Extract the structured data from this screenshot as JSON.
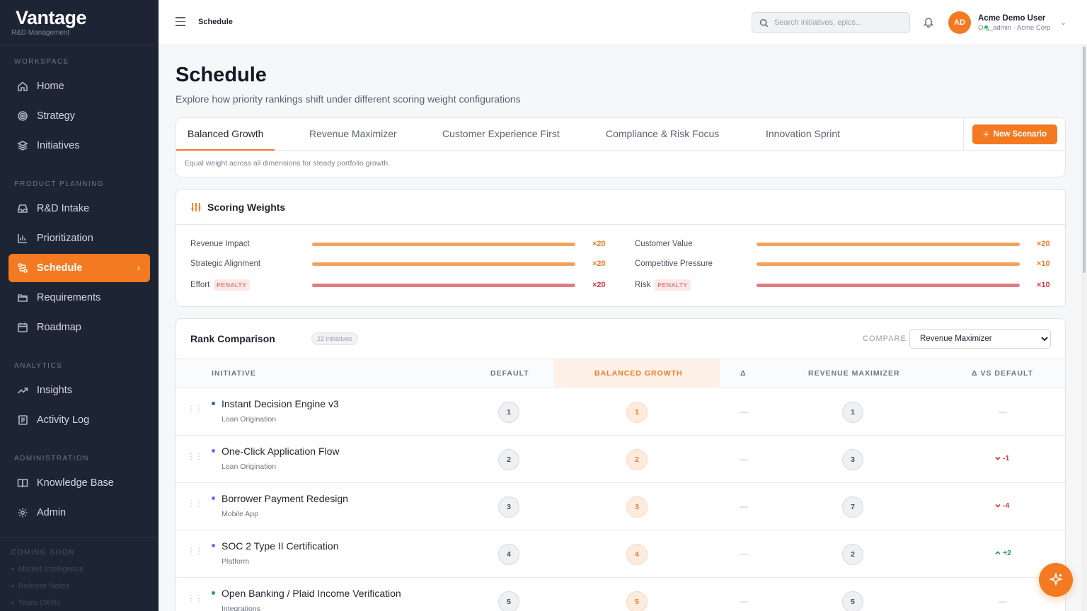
{
  "brand": {
    "name": "Vantage",
    "subtitle": "R&D Management"
  },
  "sidebar": {
    "sections": [
      {
        "title": "WORKSPACE",
        "items": [
          {
            "label": "Home",
            "icon": "home-icon"
          },
          {
            "label": "Strategy",
            "icon": "target-icon"
          },
          {
            "label": "Initiatives",
            "icon": "layers-icon"
          }
        ]
      },
      {
        "title": "PRODUCT PLANNING",
        "items": [
          {
            "label": "R&D Intake",
            "icon": "inbox-icon"
          },
          {
            "label": "Prioritization",
            "icon": "bar-chart-icon"
          },
          {
            "label": "Schedule",
            "icon": "route-icon",
            "active": true
          },
          {
            "label": "Requirements",
            "icon": "folder-icon"
          },
          {
            "label": "Roadmap",
            "icon": "calendar-icon"
          }
        ]
      },
      {
        "title": "ANALYTICS",
        "items": [
          {
            "label": "Insights",
            "icon": "trend-icon"
          },
          {
            "label": "Activity Log",
            "icon": "log-icon"
          }
        ]
      },
      {
        "title": "ADMINISTRATION",
        "items": [
          {
            "label": "Knowledge Base",
            "icon": "book-icon"
          },
          {
            "label": "Admin",
            "icon": "gear-icon"
          }
        ]
      }
    ],
    "coming_soon": {
      "title": "COMING SOON",
      "items": [
        "Market Intelligence",
        "Release Notes",
        "Team OKRs"
      ]
    }
  },
  "topbar": {
    "breadcrumb": "Schedule",
    "search_placeholder": "Search initiatives, epics...",
    "user": {
      "initials": "AD",
      "name": "Acme Demo User",
      "role": "Org_admin · Acme Corp"
    }
  },
  "page": {
    "title": "Schedule",
    "subtitle": "Explore how priority rankings shift under different scoring weight configurations"
  },
  "tabs": {
    "items": [
      "Balanced Growth",
      "Revenue Maximizer",
      "Customer Experience First",
      "Compliance & Risk Focus",
      "Innovation Sprint"
    ],
    "active": "Balanced Growth",
    "description": "Equal weight across all dimensions for steady portfolio growth.",
    "new_scenario_label": "New Scenario"
  },
  "weights": {
    "title": "Scoring Weights",
    "penalty_label": "PENALTY",
    "items": [
      {
        "label": "Revenue Impact",
        "multiplier": "×20",
        "level": 1.0,
        "penalty": false
      },
      {
        "label": "Customer Value",
        "multiplier": "×20",
        "level": 1.0,
        "penalty": false
      },
      {
        "label": "Strategic Alignment",
        "multiplier": "×20",
        "level": 1.0,
        "penalty": false
      },
      {
        "label": "Competitive Pressure",
        "multiplier": "×10",
        "level": 1.0,
        "penalty": false
      },
      {
        "label": "Effort",
        "multiplier": "×20",
        "level": 1.0,
        "penalty": true
      },
      {
        "label": "Risk",
        "multiplier": "×10",
        "level": 1.0,
        "penalty": true
      }
    ]
  },
  "rank": {
    "title": "Rank Comparison",
    "count_label": "22 initiatives",
    "compare_label": "COMPARE",
    "compare_selected": "Revenue Maximizer",
    "columns": {
      "initiative": "INITIATIVE",
      "default": "DEFAULT",
      "current": "BALANCED GROWTH",
      "delta": "Δ",
      "compare": "REVENUE MAXIMIZER",
      "delta_vs_default": "Δ VS DEFAULT"
    },
    "dash": "—",
    "rows": [
      {
        "name": "Instant Decision Engine v3",
        "team": "Loan Origination",
        "dot": "#2a6f97",
        "default": "1",
        "current": "1",
        "compare": "1",
        "delta_vs_default": "",
        "dir": "none"
      },
      {
        "name": "One-Click Application Flow",
        "team": "Loan Origination",
        "dot": "#8b5cf6",
        "default": "2",
        "current": "2",
        "compare": "3",
        "delta_vs_default": "-1",
        "dir": "down"
      },
      {
        "name": "Borrower Payment Redesign",
        "team": "Mobile App",
        "dot": "#8b5cf6",
        "default": "3",
        "current": "3",
        "compare": "7",
        "delta_vs_default": "-4",
        "dir": "down"
      },
      {
        "name": "SOC 2 Type II Certification",
        "team": "Platform",
        "dot": "#8b5cf6",
        "default": "4",
        "current": "4",
        "compare": "2",
        "delta_vs_default": "+2",
        "dir": "up"
      },
      {
        "name": "Open Banking / Plaid Income Verification",
        "team": "Integrations",
        "dot": "#22a35a",
        "default": "5",
        "current": "5",
        "compare": "5",
        "delta_vs_default": "",
        "dir": "none"
      }
    ]
  },
  "colors": {
    "accent": "#f47a22",
    "sidebar_bg": "#1d2433",
    "penalty": "#d9363e",
    "positive": "#22a35a"
  }
}
